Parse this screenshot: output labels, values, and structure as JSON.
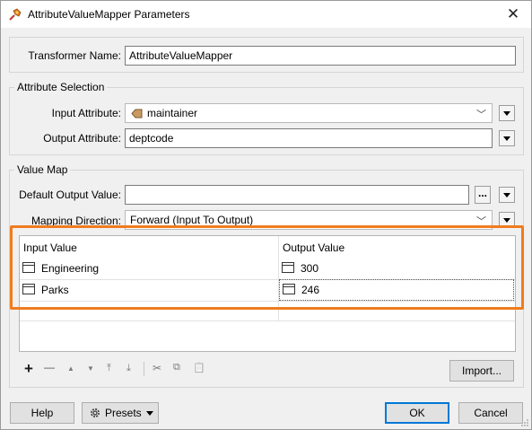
{
  "window": {
    "title": "AttributeValueMapper Parameters",
    "close_glyph": "✕"
  },
  "transformer": {
    "label": "Transformer Name:",
    "value": "AttributeValueMapper"
  },
  "attribute_selection": {
    "title": "Attribute Selection",
    "input_label": "Input Attribute:",
    "input_value": "maintainer",
    "output_label": "Output Attribute:",
    "output_value": "deptcode"
  },
  "value_map": {
    "title": "Value Map",
    "default_label": "Default Output Value:",
    "default_value": "",
    "dots_label": "...",
    "direction_label": "Mapping Direction:",
    "direction_value": "Forward (Input To Output)",
    "columns": [
      "Input Value",
      "Output Value"
    ],
    "rows": [
      {
        "input": "Engineering",
        "output": "300"
      },
      {
        "input": "Parks",
        "output": "246"
      }
    ]
  },
  "toolbar": {
    "add": "+",
    "remove": "—",
    "move_up": "▲",
    "move_down": "▼",
    "move_top": "⤒",
    "move_bottom": "⤓",
    "cut": "✂",
    "copy": "⧉",
    "paste": "📋"
  },
  "buttons": {
    "import": "Import...",
    "help": "Help",
    "presets": "Presets",
    "ok": "OK",
    "cancel": "Cancel"
  },
  "colors": {
    "highlight": "#f07c1e",
    "accent": "#0078d7"
  }
}
